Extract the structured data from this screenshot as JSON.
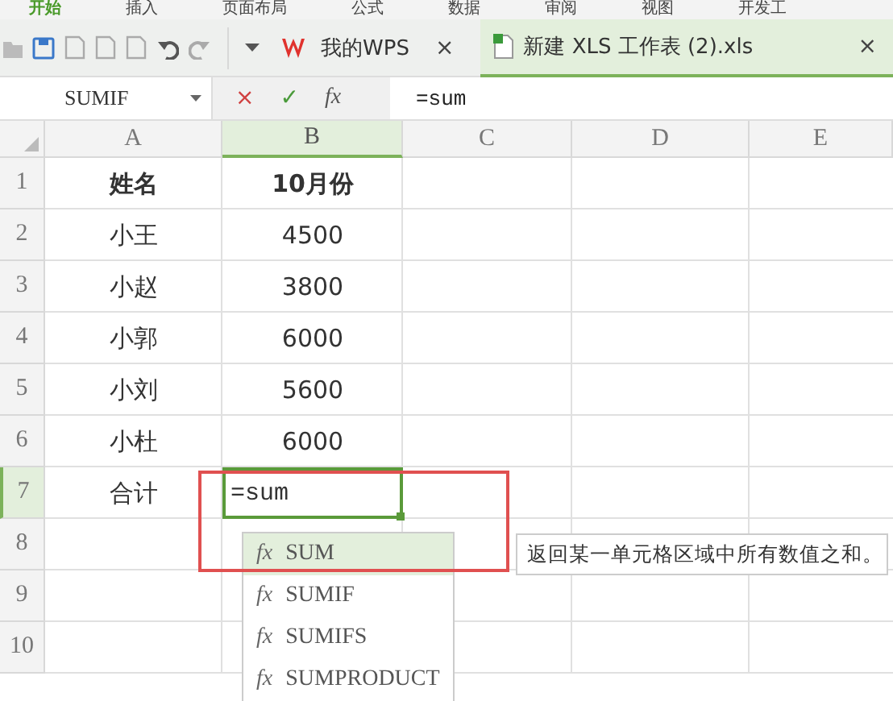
{
  "menu": [
    {
      "label": "开始",
      "selected": true
    },
    {
      "label": "插入",
      "selected": false
    },
    {
      "label": "页面布局",
      "selected": false
    },
    {
      "label": "公式",
      "selected": false
    },
    {
      "label": "数据",
      "selected": false
    },
    {
      "label": "审阅",
      "selected": false
    },
    {
      "label": "视图",
      "selected": false
    },
    {
      "label": "开发工",
      "selected": false
    }
  ],
  "document_tabs": [
    {
      "label": "我的WPS",
      "kind": "home",
      "close": "×",
      "selected": false
    },
    {
      "label": "新建 XLS 工作表 (2).xls",
      "kind": "file",
      "close": "×",
      "selected": true
    }
  ],
  "formula_bar": {
    "name_box": "SUMIF",
    "cancel": "×",
    "confirm": "✓",
    "function": "fx",
    "value": "=sum"
  },
  "columns": [
    {
      "label": "A",
      "selected": false
    },
    {
      "label": "B",
      "selected": true
    },
    {
      "label": "C",
      "selected": false
    },
    {
      "label": "D",
      "selected": false
    },
    {
      "label": "E",
      "selected": false
    }
  ],
  "rows": [
    {
      "number": "1",
      "kind": "header",
      "selected": false,
      "cells": [
        {
          "text": "姓名",
          "active": false
        },
        {
          "text": "10月份",
          "active": false
        }
      ]
    },
    {
      "number": "2",
      "kind": "data",
      "selected": false,
      "cells": [
        {
          "text": "小王",
          "active": false
        },
        {
          "text": "4500",
          "active": false
        }
      ]
    },
    {
      "number": "3",
      "kind": "data",
      "selected": false,
      "cells": [
        {
          "text": "小赵",
          "active": false
        },
        {
          "text": "3800",
          "active": false
        }
      ]
    },
    {
      "number": "4",
      "kind": "data",
      "selected": false,
      "cells": [
        {
          "text": "小郭",
          "active": false
        },
        {
          "text": "6000",
          "active": false
        }
      ]
    },
    {
      "number": "5",
      "kind": "data",
      "selected": false,
      "cells": [
        {
          "text": "小刘",
          "active": false
        },
        {
          "text": "5600",
          "active": false
        }
      ]
    },
    {
      "number": "6",
      "kind": "data",
      "selected": false,
      "cells": [
        {
          "text": "小杜",
          "active": false
        },
        {
          "text": "6000",
          "active": false
        }
      ]
    },
    {
      "number": "7",
      "kind": "data",
      "selected": true,
      "cells": [
        {
          "text": "合计",
          "active": false
        },
        {
          "text": "=sum",
          "active": true
        }
      ]
    },
    {
      "number": "8",
      "kind": "data",
      "selected": false
    },
    {
      "number": "9",
      "kind": "data",
      "selected": false
    },
    {
      "number": "10",
      "kind": "data",
      "selected": false
    }
  ],
  "autocomplete": {
    "items": [
      {
        "icon": "fx",
        "name": "SUM",
        "selected": true
      },
      {
        "icon": "fx",
        "name": "SUMIF",
        "selected": false
      },
      {
        "icon": "fx",
        "name": "SUMIFS",
        "selected": false
      },
      {
        "icon": "fx",
        "name": "SUMPRODUCT",
        "selected": false
      }
    ],
    "tooltip": "返回某一单元格区域中所有数值之和。"
  }
}
